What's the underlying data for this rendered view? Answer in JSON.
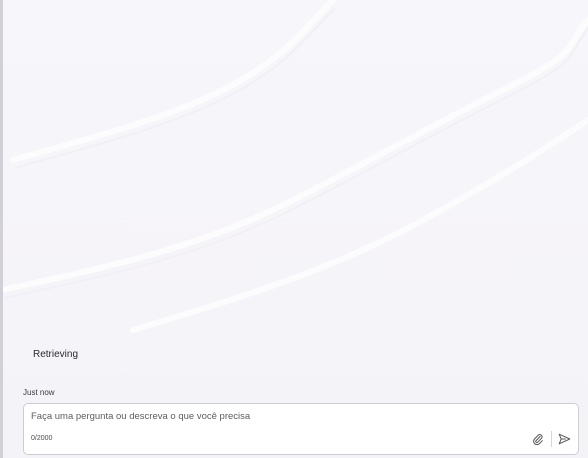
{
  "chat": {
    "status_text": "Retrieving",
    "timestamp": "Just now"
  },
  "composer": {
    "placeholder": "Faça uma pergunta ou descreva o que você precisa",
    "value": "",
    "counter": "0/2000"
  },
  "icons": {
    "attach": "paperclip-icon",
    "send": "send-icon"
  },
  "colors": {
    "background": "#f6f5f9",
    "composer_border": "#cfcdd4",
    "icon": "#555555"
  }
}
